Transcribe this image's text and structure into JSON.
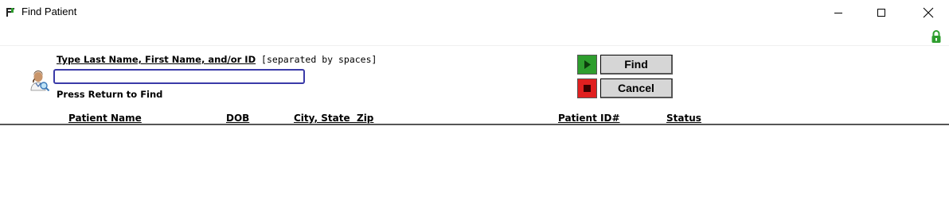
{
  "window": {
    "title": "Find Patient",
    "controls": {
      "minimize": "—",
      "maximize": "☐",
      "close": "✕"
    }
  },
  "search": {
    "instruction_bold": "Type Last Name, First Name, and/or ID",
    "instruction_normal": " [separated by spaces]",
    "value": "",
    "hint": "Press Return to Find"
  },
  "buttons": {
    "find_label": "Find",
    "cancel_label": "Cancel"
  },
  "table": {
    "columns": [
      "Patient Name",
      "DOB",
      "City, State  Zip",
      "Patient ID#",
      "Status"
    ],
    "rows": []
  },
  "colors": {
    "find_icon": "#2e9e2e",
    "cancel_icon": "#e02020",
    "lock": "#2e9e2e",
    "input_border": "#3a3aa8"
  }
}
